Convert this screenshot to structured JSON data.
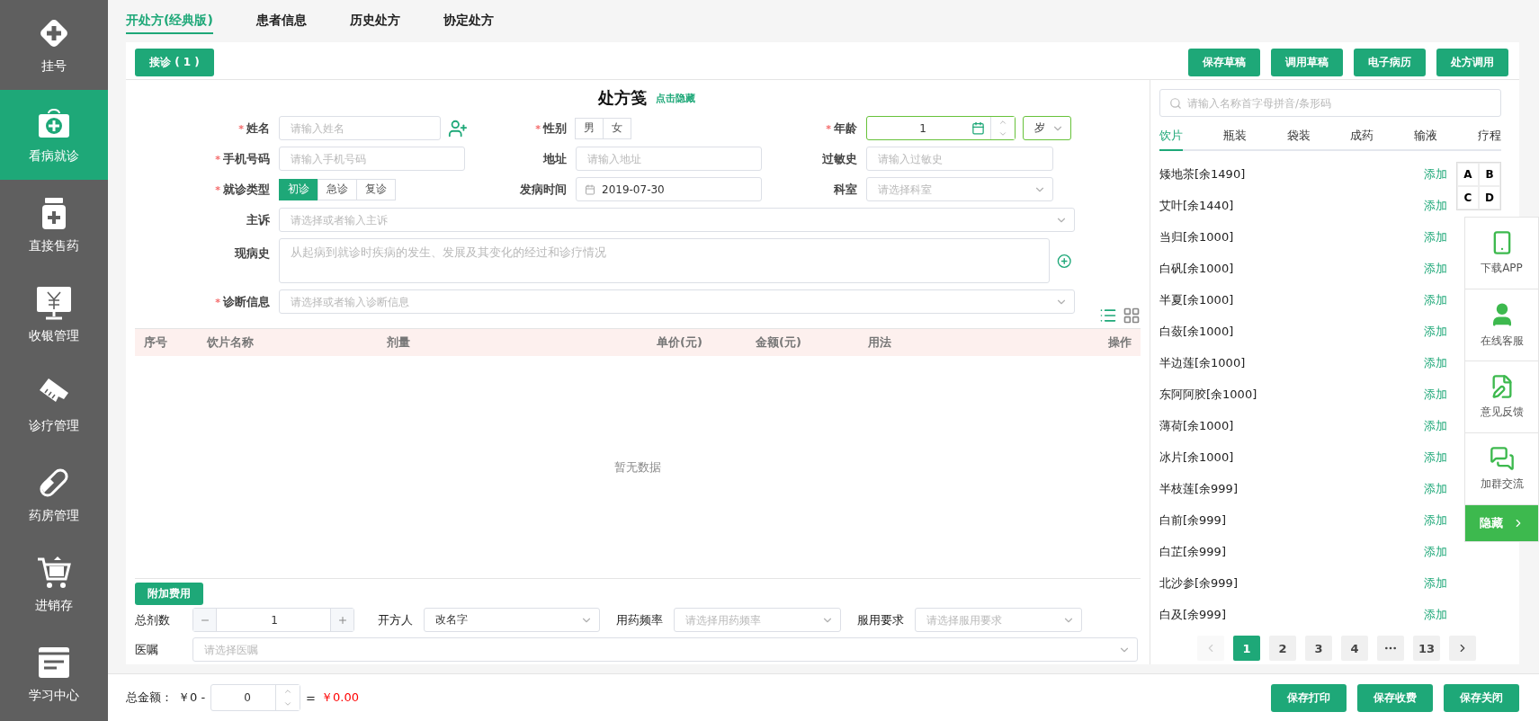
{
  "sidebar": {
    "items": [
      {
        "label": "挂号",
        "selected": false
      },
      {
        "label": "看病就诊",
        "selected": true
      },
      {
        "label": "直接售药",
        "selected": false
      },
      {
        "label": "收银管理",
        "selected": false
      },
      {
        "label": "诊疗管理",
        "selected": false
      },
      {
        "label": "药房管理",
        "selected": false
      },
      {
        "label": "进销存",
        "selected": false
      },
      {
        "label": "学习中心",
        "selected": false
      }
    ]
  },
  "top_tabs": [
    {
      "label": "开处方(经典版)",
      "selected": true
    },
    {
      "label": "患者信息",
      "selected": false
    },
    {
      "label": "历史处方",
      "selected": false
    },
    {
      "label": "协定处方",
      "selected": false
    }
  ],
  "toolbar": {
    "reception_button": "接诊 ( 1 )",
    "buttons": [
      "保存草稿",
      "调用草稿",
      "电子病历",
      "处方调用"
    ]
  },
  "form": {
    "title": "处方笺",
    "hide_link": "点击隐藏",
    "required_mark": "*",
    "name": {
      "label": "姓名",
      "required": true,
      "placeholder": "请输入姓名"
    },
    "gender": {
      "label": "性别",
      "required": true,
      "options": [
        {
          "label": "男",
          "selected": false
        },
        {
          "label": "女",
          "selected": false
        }
      ]
    },
    "age": {
      "label": "年龄",
      "required": true,
      "value": "1",
      "unit": "岁"
    },
    "phone": {
      "label": "手机号码",
      "required": true,
      "placeholder": "请输入手机号码"
    },
    "address": {
      "label": "地址",
      "required": false,
      "placeholder": "请输入地址"
    },
    "allergy": {
      "label": "过敏史",
      "required": false,
      "placeholder": "请输入过敏史"
    },
    "visit_type": {
      "label": "就诊类型",
      "required": true,
      "options": [
        {
          "label": "初诊",
          "selected": true
        },
        {
          "label": "急诊",
          "selected": false
        },
        {
          "label": "复诊",
          "selected": false
        }
      ]
    },
    "onset": {
      "label": "发病时间",
      "required": false,
      "value": "2019-07-30"
    },
    "department": {
      "label": "科室",
      "required": false,
      "placeholder": "请选择科室"
    },
    "complaint": {
      "label": "主诉",
      "required": false,
      "placeholder": "请选择或者输入主诉"
    },
    "history": {
      "label": "现病史",
      "required": false,
      "placeholder": "从起病到就诊时疾病的发生、发展及其变化的经过和诊疗情况"
    },
    "diagnosis": {
      "label": "诊断信息",
      "required": true,
      "placeholder": "请选择或者输入诊断信息"
    }
  },
  "table": {
    "columns": [
      "序号",
      "饮片名称",
      "剂量",
      "单价(元)",
      "金额(元)",
      "用法",
      "操作"
    ],
    "empty": "暂无数据"
  },
  "extras": {
    "extra_fee_button": "附加费用",
    "dose_count": {
      "label": "总剂数",
      "value": "1"
    },
    "prescriber": {
      "label": "开方人",
      "value": "改名字"
    },
    "frequency": {
      "label": "用药频率",
      "placeholder": "请选择用药频率"
    },
    "requirement": {
      "label": "服用要求",
      "placeholder": "请选择服用要求"
    },
    "advice": {
      "label": "医嘱",
      "placeholder": "请选择医嘱"
    }
  },
  "drug_panel": {
    "search_placeholder": "请输入名称首字母拼音/条形码",
    "tabs": [
      {
        "label": "饮片",
        "selected": true
      },
      {
        "label": "瓶装",
        "selected": false
      },
      {
        "label": "袋装",
        "selected": false
      },
      {
        "label": "成药",
        "selected": false
      },
      {
        "label": "输液",
        "selected": false
      },
      {
        "label": "疗程",
        "selected": false
      }
    ],
    "items": [
      {
        "name": "矮地茶[余1490]",
        "action": "添加"
      },
      {
        "name": "艾叶[余1440]",
        "action": "添加"
      },
      {
        "name": "当归[余1000]",
        "action": "添加"
      },
      {
        "name": "白矾[余1000]",
        "action": "添加"
      },
      {
        "name": "半夏[余1000]",
        "action": "添加"
      },
      {
        "name": "白蔹[余1000]",
        "action": "添加"
      },
      {
        "name": "半边莲[余1000]",
        "action": "添加"
      },
      {
        "name": "东阿阿胶[余1000]",
        "action": "添加"
      },
      {
        "name": "薄荷[余1000]",
        "action": "添加"
      },
      {
        "name": "冰片[余1000]",
        "action": "添加"
      },
      {
        "name": "半枝莲[余999]",
        "action": "添加"
      },
      {
        "name": "白前[余999]",
        "action": "添加"
      },
      {
        "name": "白芷[余999]",
        "action": "添加"
      },
      {
        "name": "北沙参[余999]",
        "action": "添加"
      },
      {
        "name": "白及[余999]",
        "action": "添加"
      }
    ],
    "letters": [
      "A",
      "B",
      "C",
      "D"
    ],
    "pagination": [
      {
        "kind": "prev",
        "disabled": true
      },
      {
        "kind": "page",
        "label": "1",
        "selected": true
      },
      {
        "kind": "page",
        "label": "2",
        "selected": false
      },
      {
        "kind": "page",
        "label": "3",
        "selected": false
      },
      {
        "kind": "page",
        "label": "4",
        "selected": false
      },
      {
        "kind": "ellipsis"
      },
      {
        "kind": "page",
        "label": "13",
        "selected": false
      },
      {
        "kind": "next",
        "disabled": false
      }
    ]
  },
  "float_widget": {
    "items": [
      "下载APP",
      "在线客服",
      "意见反馈",
      "加群交流"
    ],
    "hide_button": "隐藏"
  },
  "footer": {
    "total_label": "总金额：",
    "base": "￥0 -",
    "discount": "0",
    "equals": "=",
    "total": "￥0.00",
    "buttons": [
      "保存打印",
      "保存收费",
      "保存关闭"
    ]
  }
}
